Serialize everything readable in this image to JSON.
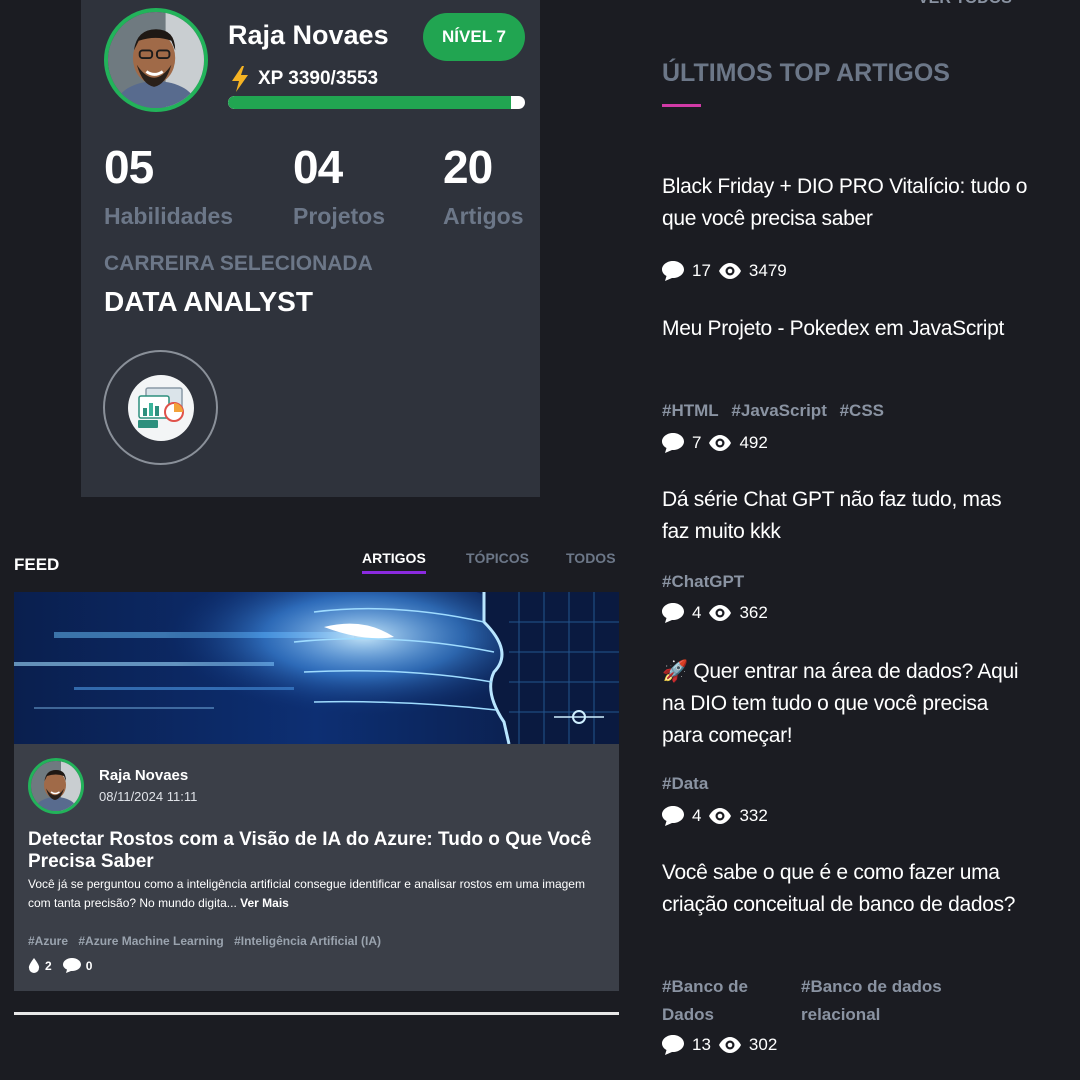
{
  "profile": {
    "name": "Raja Novaes",
    "level_badge": "NÍVEL 7",
    "xp_text": "XP 3390/3553",
    "xp_progress": 0.954,
    "stats": [
      {
        "value": "05",
        "label": "Habilidades"
      },
      {
        "value": "04",
        "label": "Projetos"
      },
      {
        "value": "20",
        "label": "Artigos"
      }
    ],
    "career_label": "CARREIRA SELECIONADA",
    "career_name": "DATA ANALYST"
  },
  "feed": {
    "title": "FEED",
    "tabs": [
      {
        "label": "ARTIGOS",
        "active": true
      },
      {
        "label": "TÓPICOS",
        "active": false
      },
      {
        "label": "TODOS",
        "active": false
      }
    ],
    "post": {
      "author": "Raja Novaes",
      "date": "08/11/2024 11:11",
      "title": "Detectar Rostos com a Visão de IA do Azure: Tudo o Que Você Precisa Saber",
      "excerpt": "Você já se perguntou como a inteligência artificial consegue identificar e analisar rostos em uma imagem com tanta precisão? No mundo digita...",
      "read_more": "Ver Mais",
      "tags": [
        "#Azure",
        "#Azure Machine Learning",
        "#Inteligência Artificial (IA)"
      ],
      "likes": "2",
      "comments": "0"
    }
  },
  "top_articles": {
    "see_all": "VER TODOS",
    "heading": "ÚLTIMOS TOP ARTIGOS",
    "accent_color": "#d13aa6",
    "items": [
      {
        "title": "Black Friday + DIO PRO Vitalício: tudo o que você precisa saber",
        "tags": [],
        "comments": "17",
        "views": "3479"
      },
      {
        "title": "Meu Projeto - Pokedex em JavaScript",
        "tags": [
          "#HTML",
          "#JavaScript",
          "#CSS"
        ],
        "comments": "7",
        "views": "492"
      },
      {
        "title": "Dá série Chat GPT não faz tudo, mas faz muito kkk",
        "tags": [
          "#ChatGPT"
        ],
        "comments": "4",
        "views": "362"
      },
      {
        "title": "🚀 Quer entrar na área de dados? Aqui na DIO tem tudo o que você precisa para começar!",
        "tags": [
          "#Data"
        ],
        "comments": "4",
        "views": "332"
      },
      {
        "title": "Você sabe o que é e como fazer uma criação conceitual de banco de dados?",
        "tags": [
          "#Banco de Dados",
          "#Banco de dados relacional"
        ],
        "comments": "13",
        "views": "302"
      }
    ]
  }
}
